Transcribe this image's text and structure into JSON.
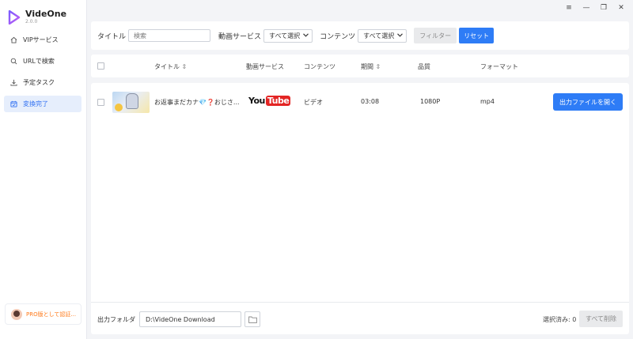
{
  "app": {
    "name": "VideOne",
    "version": "2.0.0"
  },
  "window_controls": {
    "menu": "≡",
    "minimize": "—",
    "restore": "❐",
    "close": "✕"
  },
  "sidebar": {
    "items": [
      {
        "label": "VIPサービス",
        "icon": "home-icon"
      },
      {
        "label": "URLで検索",
        "icon": "search-icon"
      },
      {
        "label": "予定タスク",
        "icon": "download-icon"
      },
      {
        "label": "変換完了",
        "icon": "calendar-check-icon",
        "active": true
      }
    ],
    "pro_label": "PRO版として認証..."
  },
  "filter": {
    "title_label": "タイトル",
    "search_placeholder": "検索",
    "service_label": "動画サービス",
    "service_value": "すべて選択",
    "content_label": "コンテンツ",
    "content_value": "すべて選択",
    "filter_button": "フィルター",
    "reset_button": "リセット"
  },
  "table": {
    "headers": {
      "title": "タイトル",
      "service": "動画サービス",
      "content": "コンテンツ",
      "duration": "期間",
      "quality": "品質",
      "format": "フォーマット"
    },
    "rows": [
      {
        "title": "お返事まだカナ💎❓おじさ...",
        "service_you": "You",
        "service_tube": "Tube",
        "content": "ビデオ",
        "duration": "03:08",
        "quality": "1080P",
        "format": "mp4",
        "action": "出力ファイルを開く"
      }
    ]
  },
  "footer": {
    "output_label": "出力フォルダ",
    "output_path": "D:\\VideOne Download",
    "selected_text": "選択済み: 0",
    "delete_all": "すべて削除"
  },
  "colors": {
    "accent": "#2e7cf6",
    "sidebar_active_bg": "#e6eefc",
    "youtube_red": "#e32524",
    "pro_orange": "#ff7a1a"
  }
}
